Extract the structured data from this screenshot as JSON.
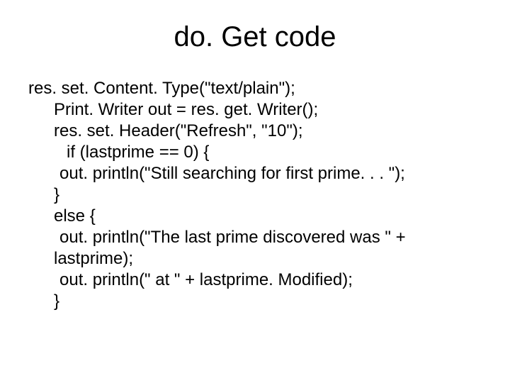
{
  "slide": {
    "title": "do. Get code",
    "code_lines": [
      {
        "text": "res. set. Content. Type(\"text/plain\");",
        "indent": 0
      },
      {
        "text": "Print. Writer out = res. get. Writer();",
        "indent": 1
      },
      {
        "text": "res. set. Header(\"Refresh\", \"10\");",
        "indent": 1
      },
      {
        "text": "if (lastprime == 0) {",
        "indent": 2
      },
      {
        "text": "out. println(\"Still searching for first prime. . . \");",
        "indent": 3
      },
      {
        "text": "}",
        "indent": 1
      },
      {
        "text": "else {",
        "indent": 1
      },
      {
        "text": "out. println(\"The last prime discovered was \" +",
        "indent": 3
      },
      {
        "text": "lastprime);",
        "indent": 1
      },
      {
        "text": "out. println(\" at \" + lastprime. Modified);",
        "indent": 3
      },
      {
        "text": "}",
        "indent": 1
      }
    ]
  }
}
